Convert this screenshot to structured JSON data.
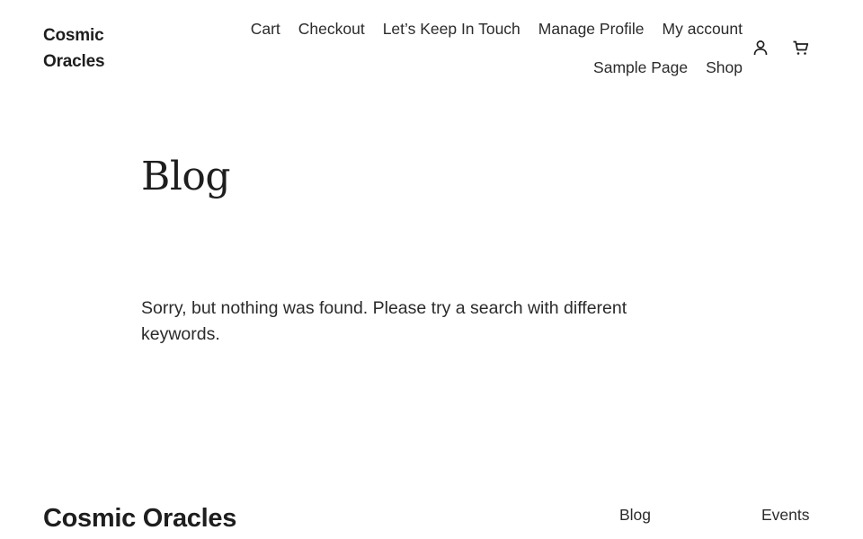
{
  "header": {
    "site_title": "Cosmic Oracles",
    "nav": [
      {
        "label": "Cart"
      },
      {
        "label": "Checkout"
      },
      {
        "label": "Let’s Keep In Touch"
      },
      {
        "label": "Manage Profile"
      },
      {
        "label": "My account"
      },
      {
        "label": "Sample Page"
      },
      {
        "label": "Shop"
      }
    ],
    "icons": {
      "account": "account-icon",
      "cart": "cart-icon"
    }
  },
  "main": {
    "heading": "Blog",
    "no_results_text": "Sorry, but nothing was found. Please try a search with different keywords."
  },
  "footer": {
    "site_title": "Cosmic Oracles",
    "links": [
      {
        "label": "Blog"
      },
      {
        "label": "Events"
      }
    ]
  },
  "colors": {
    "background": "#ffffff",
    "text": "#1e1e1e"
  }
}
